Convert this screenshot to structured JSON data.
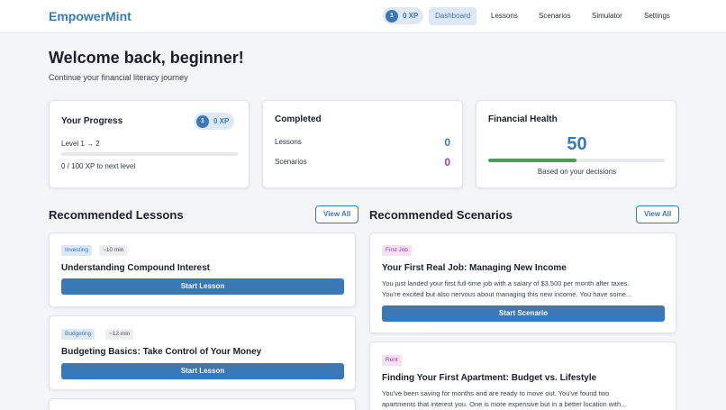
{
  "app": {
    "name": "EmpowerMint"
  },
  "nav": {
    "level": "1",
    "xp": "0 XP",
    "links": [
      "Dashboard",
      "Lessons",
      "Scenarios",
      "Simulator",
      "Settings"
    ],
    "active": "Dashboard"
  },
  "welcome": {
    "title": "Welcome back, beginner!",
    "subtitle": "Continue your financial literacy journey"
  },
  "progress_card": {
    "title": "Your Progress",
    "level": "1",
    "xp": "0 XP",
    "level_text": "Level 1 → 2",
    "progress_fraction": 0.0,
    "xp_text": "0 / 100 XP to next level"
  },
  "completed_card": {
    "title": "Completed",
    "lessons_label": "Lessons",
    "lessons_value": "0",
    "scenarios_label": "Scenarios",
    "scenarios_value": "0"
  },
  "health_card": {
    "title": "Financial Health",
    "score": "50",
    "score_fraction": 0.5,
    "caption": "Based on your decisions"
  },
  "lessons": {
    "title": "Recommended Lessons",
    "view_all": "View All",
    "items": [
      {
        "tag": "Investing",
        "duration": "~10 min",
        "title": "Understanding Compound Interest",
        "button": "Start Lesson"
      },
      {
        "tag": "Budgeting",
        "duration": "~12 min",
        "title": "Budgeting Basics: Take Control of Your Money",
        "button": "Start Lesson"
      }
    ]
  },
  "scenarios": {
    "title": "Recommended Scenarios",
    "view_all": "View All",
    "items": [
      {
        "tag": "First Job",
        "title": "Your First Real Job: Managing New Income",
        "desc_line1": "You just landed your first full-time job with a salary of $3,500 per month after taxes.",
        "desc_line2": "You're excited but also nervous about managing this new income. You have some...",
        "button": "Start Scenario"
      },
      {
        "tag": "Rent",
        "title": "Finding Your First Apartment: Budget vs. Lifestyle",
        "desc_line1": "You've been saving for months and are ready to move out. You've found two",
        "desc_line2": "apartments that interest you. One is more expensive but in a better location with..."
      }
    ]
  },
  "colors": {
    "accent": "#3a78b7",
    "scenarios_count": "#a238a2",
    "health_bar": "#4a9e58"
  }
}
